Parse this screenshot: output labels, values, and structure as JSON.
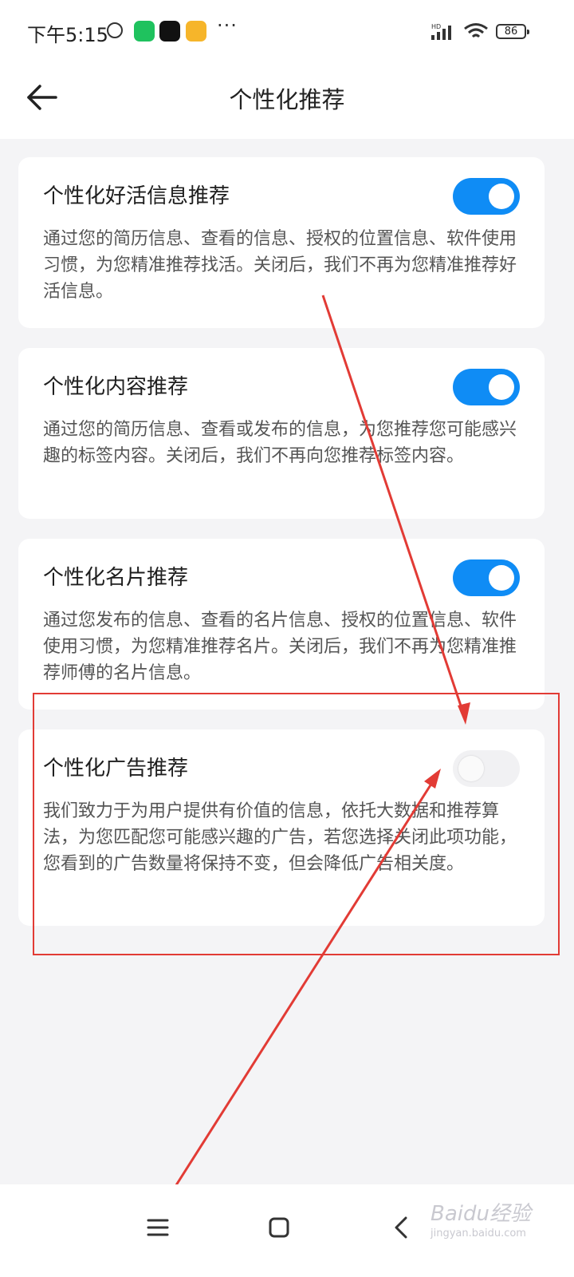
{
  "status_bar": {
    "time": "下午5:15",
    "battery": "86",
    "network": "HD"
  },
  "header": {
    "title": "个性化推荐"
  },
  "settings": [
    {
      "title": "个性化好活信息推荐",
      "description": "通过您的简历信息、查看的信息、授权的位置信息、软件使用习惯，为您精准推荐找活。关闭后，我们不再为您精准推荐好活信息。",
      "enabled": true
    },
    {
      "title": "个性化内容推荐",
      "description": "通过您的简历信息、查看或发布的信息，为您推荐您可能感兴趣的标签内容。关闭后，我们不再向您推荐标签内容。",
      "enabled": true
    },
    {
      "title": "个性化名片推荐",
      "description": "通过您发布的信息、查看的名片信息、授权的位置信息、软件使用习惯，为您精准推荐名片。关闭后，我们不再为您精准推荐师傅的名片信息。",
      "enabled": true
    },
    {
      "title": "个性化广告推荐",
      "description": "我们致力于为用户提供有价值的信息，依托大数据和推荐算法，为您匹配您可能感兴趣的广告，若您选择关闭此项功能，您看到的广告数量将保持不变，但会降低广告相关度。",
      "enabled": false
    }
  ],
  "watermark": {
    "text": "Baidu经验",
    "sub": "jingyan.baidu.com"
  },
  "colors": {
    "toggle_on": "#0f8cf5",
    "toggle_off": "#f1f1f3",
    "annotation": "#e23b35",
    "background": "#f4f4f6"
  }
}
